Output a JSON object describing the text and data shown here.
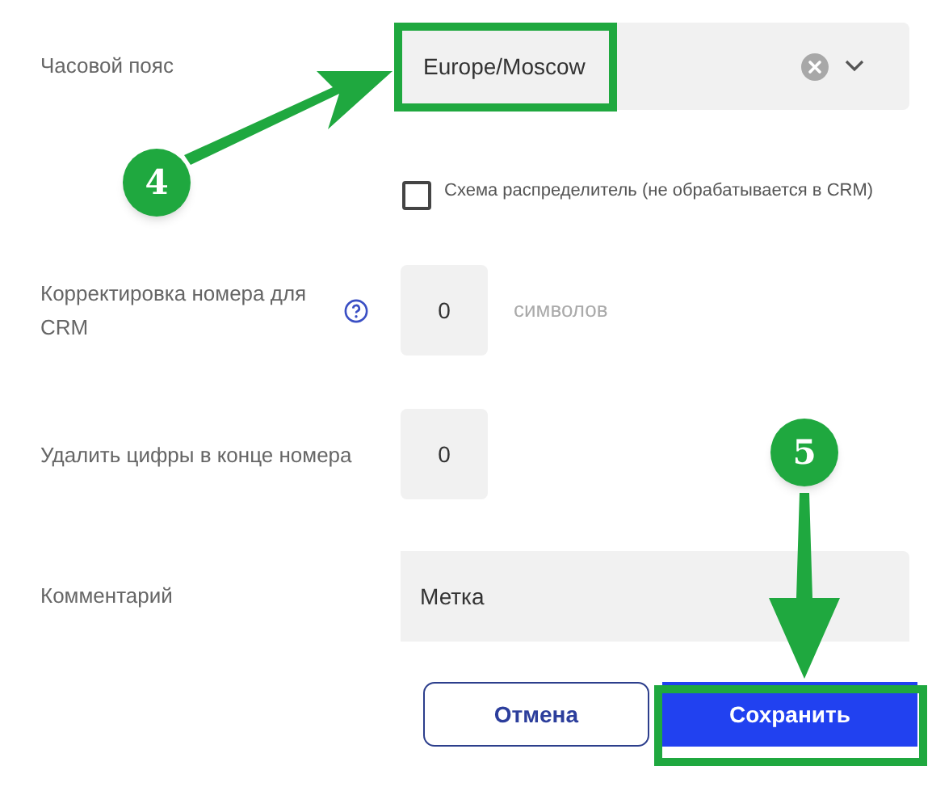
{
  "fields": [
    {
      "kind": "select",
      "label": "Часовой пояс",
      "value": "Europe/Moscow"
    },
    {
      "kind": "checkbox",
      "label": "Схема распределитель (не обрабатывается в CRM)",
      "checked": false
    },
    {
      "kind": "number",
      "label": "Корректировка номера для CRM",
      "help": true,
      "value": "0",
      "suffix": "символов"
    },
    {
      "kind": "number",
      "label": "Удалить цифры в конце номера",
      "help": false,
      "value": "0"
    },
    {
      "kind": "text",
      "label": "Комментарий",
      "value": "Метка"
    }
  ],
  "buttons": [
    {
      "label": "Отмена",
      "kind": "secondary"
    },
    {
      "label": "Сохранить",
      "kind": "primary"
    }
  ],
  "annotations": [
    {
      "number": "4"
    },
    {
      "number": "5"
    }
  ]
}
